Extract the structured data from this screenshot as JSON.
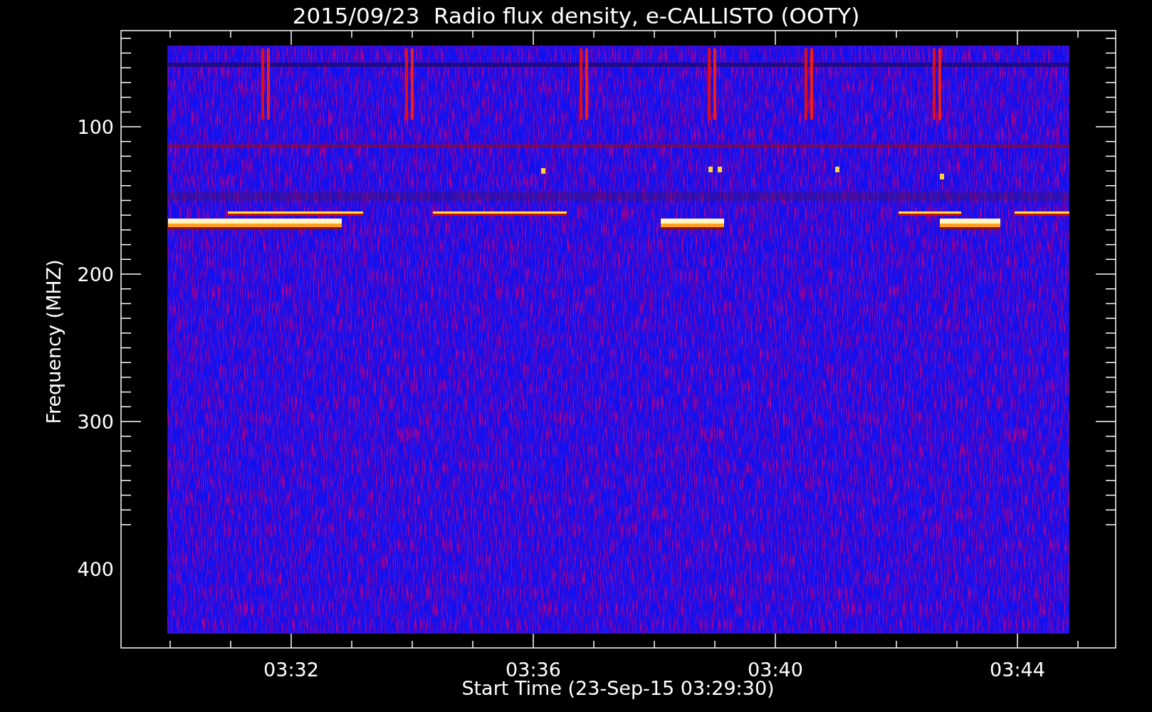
{
  "title": "2015/09/23  Radio flux density, e-CALLISTO (OOTY)",
  "y_axis": {
    "label": "Frequency (MHZ)",
    "ticks": [
      "100",
      "200",
      "300",
      "400"
    ]
  },
  "x_axis": {
    "label": "Start Time (23-Sep-15 03:29:30)",
    "ticks": [
      "03:32",
      "03:36",
      "03:40",
      "03:44"
    ]
  }
}
